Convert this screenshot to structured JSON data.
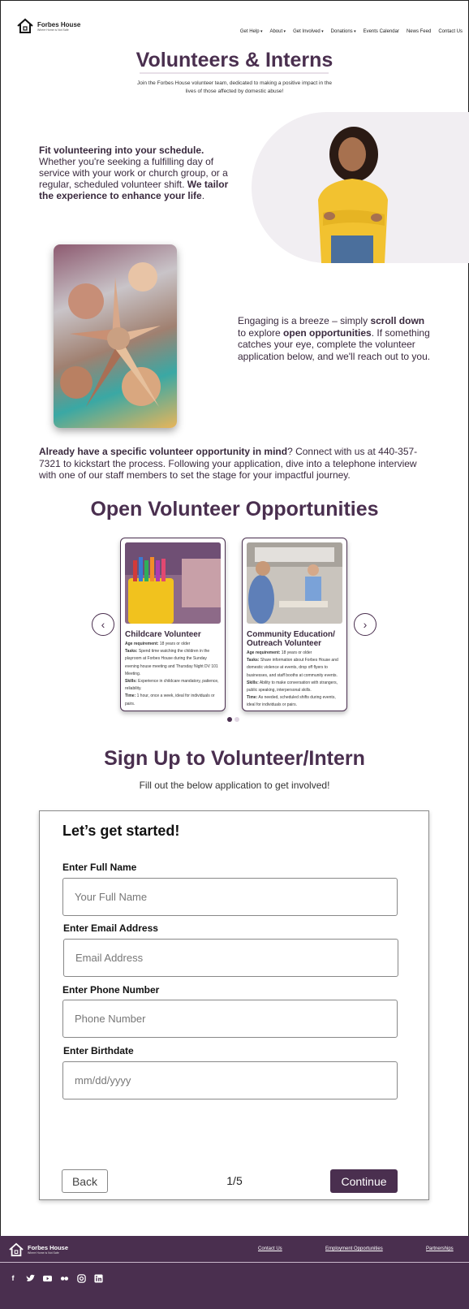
{
  "header": {
    "brand": "Forbes House",
    "tagline": "Where Home is Not Safe",
    "nav": [
      {
        "label": "Get Help",
        "dropdown": true
      },
      {
        "label": "About",
        "dropdown": true
      },
      {
        "label": "Get Involved",
        "dropdown": true
      },
      {
        "label": "Donations",
        "dropdown": true
      },
      {
        "label": "Events Calendar",
        "dropdown": false
      },
      {
        "label": "News Feed",
        "dropdown": false
      },
      {
        "label": "Contact Us",
        "dropdown": false
      }
    ]
  },
  "hero": {
    "title": "Volunteers & Interns",
    "subtitle": "Join the Forbes House volunteer team, dedicated to making a positive impact in the lives of those affected by domestic abuse!"
  },
  "intro1": {
    "bold1": "Fit volunteering into your schedule.",
    "text": " Whether you're seeking a fulfilling day of service with your work or church group, or a regular, scheduled volunteer shift. ",
    "bold2": "We tailor the experience to enhance your life",
    "end": "."
  },
  "intro2": {
    "t1": "Engaging is a breeze – simply ",
    "b1": "scroll down",
    "t2": " to explore ",
    "b2": "open opportunities",
    "t3": ". If something catches your eye, complete the volunteer application below, and we'll reach out to you."
  },
  "intro3": {
    "bold": "Already have a specific volunteer opportunity in mind",
    "text": "? Connect with us at 440-357-7321 to kickstart the process. Following your application, dive into a telephone interview with one of our staff members to set the stage for your impactful journey."
  },
  "opportunities": {
    "title": "Open Volunteer Opportunities",
    "cards": [
      {
        "title": "Childcare Volunteer",
        "age_label": "Age requirement:",
        "age": " 18 years or older",
        "tasks_label": "Tasks:",
        "tasks": " Spend time watching the children in the playroom at Forbes House during the Sunday evening house meeting and Thursday Night DV 101 Meeting.",
        "skills_label": "Skills:",
        "skills": " Experience in childcare mandatory, patience, reliability.",
        "time_label": "Time:",
        "time": " 1 hour, once a week, ideal for individuals or pairs."
      },
      {
        "title": "Community Education/ Outreach Volunteer",
        "age_label": "Age requirement:",
        "age": " 18 years or older",
        "tasks_label": "Tasks:",
        "tasks": " Share information about Forbes House and domestic violence at events, drop off flyers to businesses, and staff booths at community events.",
        "skills_label": "Skills:",
        "skills": " Ability to make conversation with strangers, public speaking, interpersonal skills.",
        "time_label": "Time:",
        "time": " As needed, scheduled shifts during events, ideal for individuals or pairs."
      }
    ],
    "prev_icon": "‹",
    "next_icon": "›",
    "page_count": 2,
    "active_page": 1
  },
  "signup": {
    "title": "Sign Up to Volunteer/Intern",
    "subtitle": "Fill out the below application to get involved!"
  },
  "form": {
    "title": "Let’s get started!",
    "fields": [
      {
        "label": "Enter Full Name",
        "placeholder": "Your Full Name"
      },
      {
        "label": "Enter Email Address",
        "placeholder": "Email Address"
      },
      {
        "label": "Enter Phone Number",
        "placeholder": "Phone Number"
      },
      {
        "label": "Enter Birthdate",
        "placeholder": "mm/dd/yyyy"
      }
    ],
    "back_label": "Back",
    "step": "1/5",
    "continue_label": "Continue"
  },
  "footer": {
    "brand": "Forbes House",
    "tagline": "Where Home is Not Safe",
    "links": [
      "Contact Us",
      "Employment Opportunities",
      "Partnerships"
    ],
    "socials": [
      "facebook-icon",
      "twitter-icon",
      "youtube-icon",
      "flickr-icon",
      "instagram-icon",
      "linkedin-icon"
    ]
  },
  "colors": {
    "brand": "#4a2f4f",
    "accent_light": "#f1eef2"
  }
}
